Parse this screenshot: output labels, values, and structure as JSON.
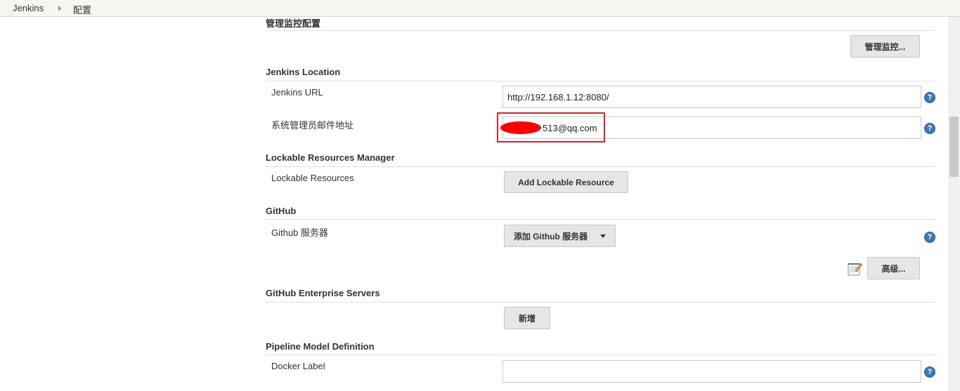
{
  "breadcrumb": {
    "root": "Jenkins",
    "current": "配置"
  },
  "sections": {
    "monitoring": {
      "title": "管理监控配置",
      "button": "管理监控..."
    },
    "location": {
      "title": "Jenkins Location",
      "url_label": "Jenkins URL",
      "url_value": "http://192.168.1.12:8080/",
      "email_label": "系统管理员邮件地址",
      "email_value": "513@qq.com"
    },
    "lockable": {
      "title": "Lockable Resources Manager",
      "label": "Lockable Resources",
      "button": "Add Lockable Resource"
    },
    "github": {
      "title": "GitHub",
      "label": "Github 服务器",
      "add_button": "添加 Github 服务器",
      "advanced_button": "高级..."
    },
    "enterprise": {
      "title": "GitHub Enterprise Servers",
      "button": "新增"
    },
    "pipeline": {
      "title": "Pipeline Model Definition",
      "label": "Docker Label",
      "value": ""
    }
  },
  "icons": {
    "help": "help-icon",
    "notepad": "notepad-icon",
    "dropdown": "chevron-down-icon"
  },
  "colors": {
    "help": "#3d77b8",
    "highlight": "#d9232e",
    "redaction": "#ff0000"
  }
}
